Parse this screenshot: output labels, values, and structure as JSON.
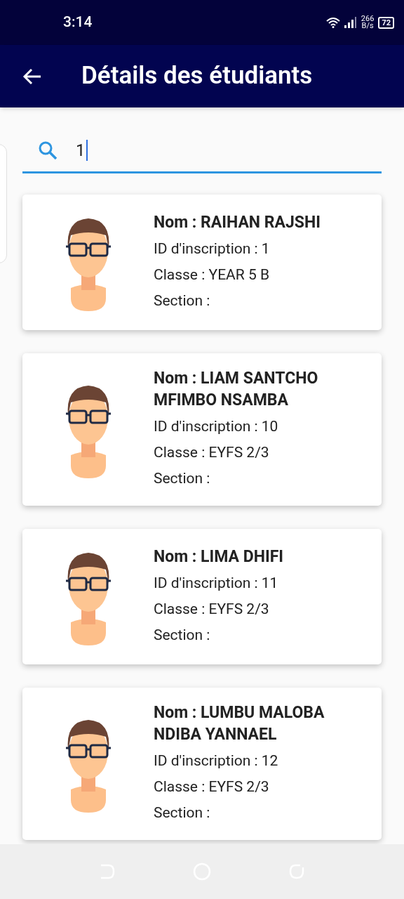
{
  "status_bar": {
    "time": "3:14",
    "speed": "266",
    "speed_unit": "B/s",
    "battery": "72"
  },
  "app_bar": {
    "title": "Détails des étudiants"
  },
  "search": {
    "value": "1"
  },
  "students": [
    {
      "name": "Nom : RAIHAN RAJSHI",
      "id": "ID d'inscription : 1",
      "class": "Classe : YEAR 5 B",
      "section": "Section :"
    },
    {
      "name": "Nom : LIAM SANTCHO MFIMBO NSAMBA",
      "id": "ID d'inscription : 10",
      "class": "Classe : EYFS 2/3",
      "section": "Section :"
    },
    {
      "name": "Nom : LIMA DHIFI",
      "id": "ID d'inscription : 11",
      "class": "Classe : EYFS 2/3",
      "section": "Section :"
    },
    {
      "name": "Nom : LUMBU MALOBA NDIBA YANNAEL",
      "id": "ID d'inscription : 12",
      "class": "Classe : EYFS 2/3",
      "section": "Section :"
    }
  ]
}
